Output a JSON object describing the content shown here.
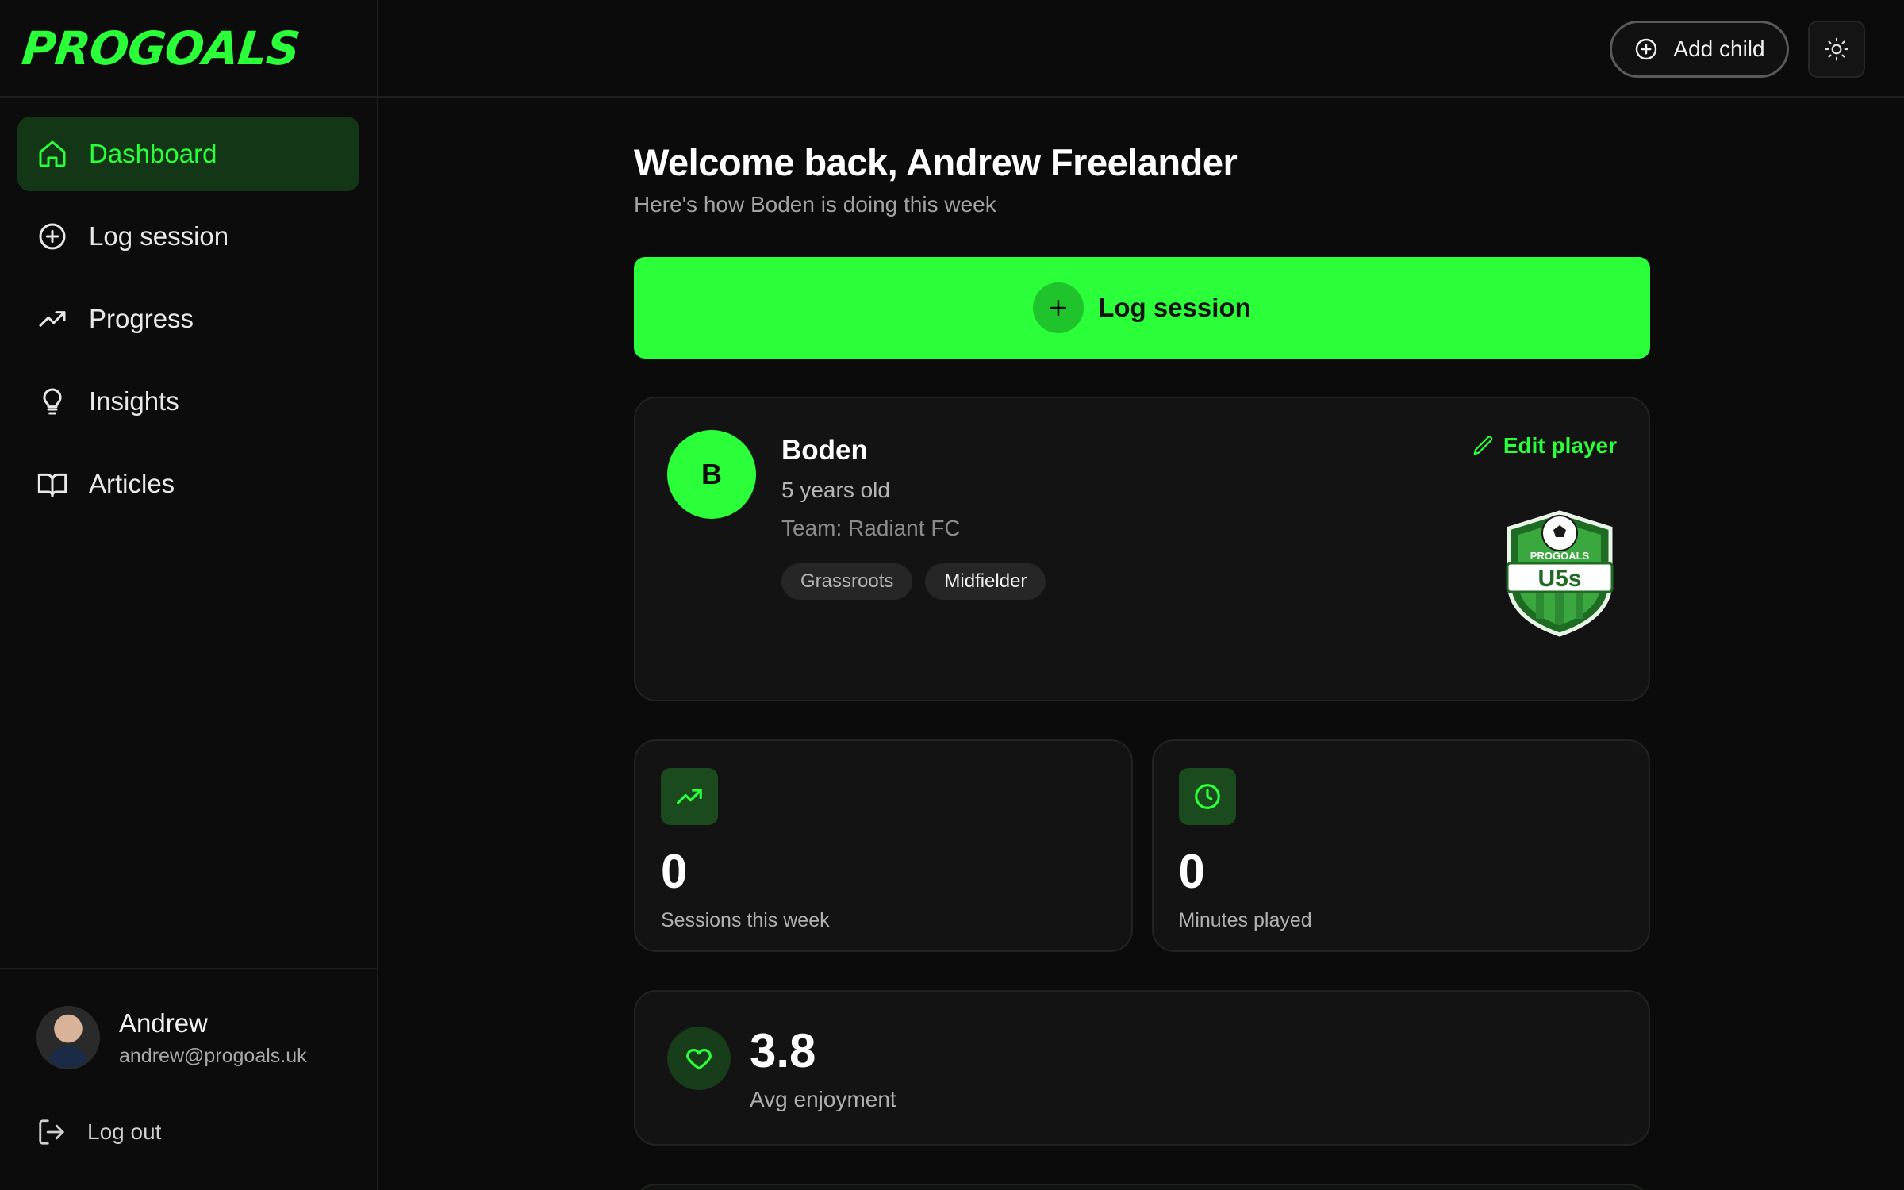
{
  "brand": {
    "logo_text": "PROGOALS"
  },
  "sidebar": {
    "items": [
      {
        "label": "Dashboard",
        "icon": "home-icon",
        "active": true
      },
      {
        "label": "Log session",
        "icon": "plus-circle-icon",
        "active": false
      },
      {
        "label": "Progress",
        "icon": "trending-up-icon",
        "active": false
      },
      {
        "label": "Insights",
        "icon": "lightbulb-icon",
        "active": false
      },
      {
        "label": "Articles",
        "icon": "book-open-icon",
        "active": false
      }
    ],
    "user": {
      "name": "Andrew",
      "email": "andrew@progoals.uk"
    },
    "logout_label": "Log out"
  },
  "topbar": {
    "add_child_label": "Add child",
    "theme_icon": "sun-icon"
  },
  "main": {
    "welcome": "Welcome back, Andrew Freelander",
    "subtitle": "Here's how Boden is doing this week",
    "cta_label": "Log session",
    "player": {
      "initial": "B",
      "name": "Boden",
      "age": "5 years old",
      "team": "Team: Radiant FC",
      "tags": [
        "Grassroots",
        "Midfielder"
      ],
      "edit_label": "Edit player",
      "badge": {
        "top_text": "PROGOALS",
        "main_text": "U5s"
      }
    },
    "stats": [
      {
        "value": "0",
        "label": "Sessions this week",
        "icon": "trending-up-icon"
      },
      {
        "value": "0",
        "label": "Minutes played",
        "icon": "clock-icon"
      }
    ],
    "enjoyment": {
      "value": "3.8",
      "label": "Avg enjoyment",
      "icon": "heart-icon"
    }
  },
  "colors": {
    "accent": "#2bff3a",
    "background": "#0b0b0b",
    "card": "#131313",
    "active_nav_bg": "#133716"
  }
}
